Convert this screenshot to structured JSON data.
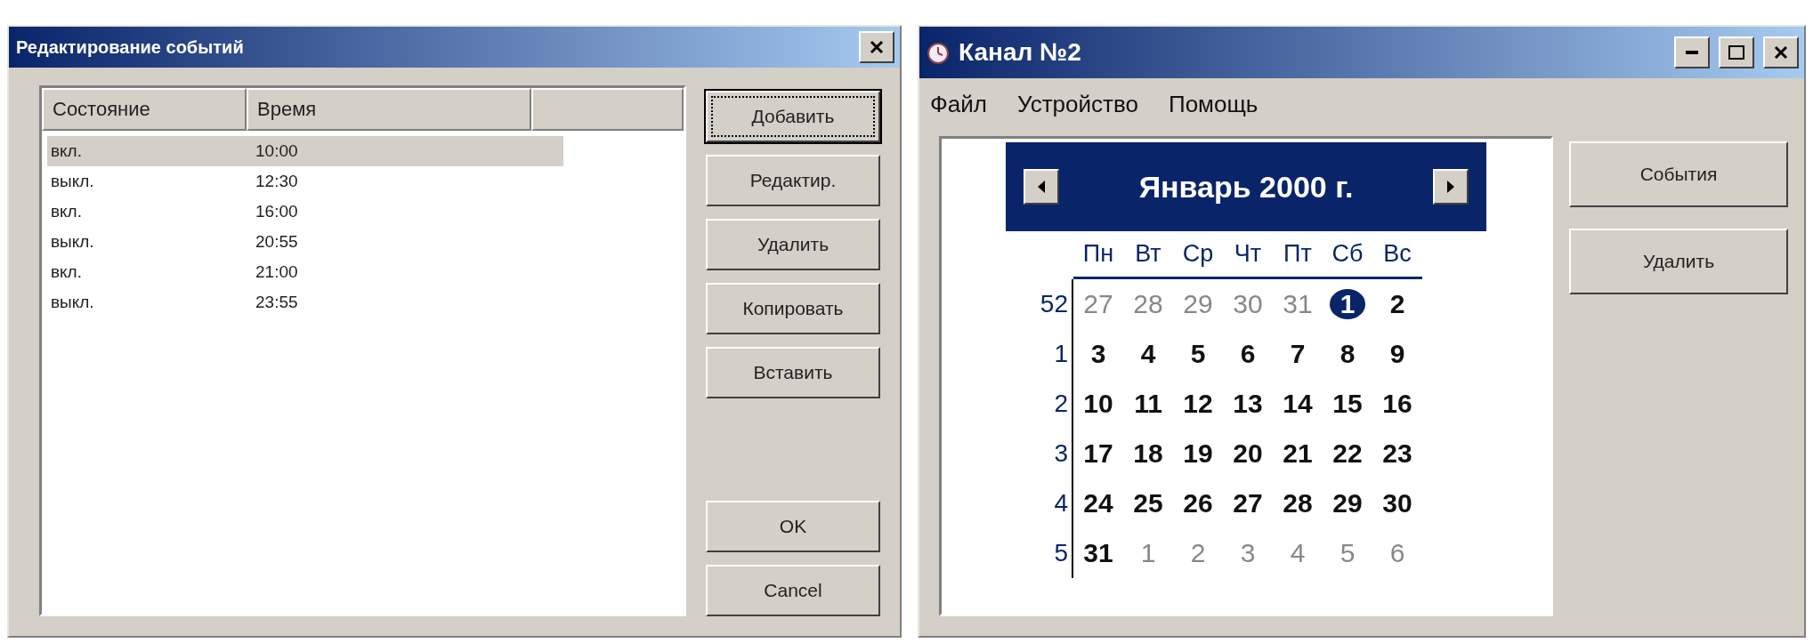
{
  "events_dialog": {
    "title": "Редактирование событий",
    "columns": [
      "Состояние",
      "Время"
    ],
    "rows": [
      {
        "state": "вкл.",
        "time": "10:00",
        "selected": true
      },
      {
        "state": "выкл.",
        "time": "12:30",
        "selected": false
      },
      {
        "state": "вкл.",
        "time": "16:00",
        "selected": false
      },
      {
        "state": "выкл.",
        "time": "20:55",
        "selected": false
      },
      {
        "state": "вкл.",
        "time": "21:00",
        "selected": false
      },
      {
        "state": "выкл.",
        "time": "23:55",
        "selected": false
      }
    ],
    "buttons": [
      {
        "label": "Добавить",
        "focused": true
      },
      {
        "label": "Редактир.",
        "focused": false
      },
      {
        "label": "Удалить",
        "focused": false
      },
      {
        "label": "Копировать",
        "focused": false
      },
      {
        "label": "Вставить",
        "focused": false
      }
    ],
    "footer_buttons": [
      "OK",
      "Cancel"
    ]
  },
  "channel_window": {
    "title": "Канал №2",
    "menu": [
      "Файл",
      "Устройство",
      "Помощь"
    ],
    "calendar": {
      "month": "Январь 2000 г.",
      "weekdays": [
        "Пн",
        "Вт",
        "Ср",
        "Чт",
        "Пт",
        "Сб",
        "Вс"
      ],
      "weeks": [
        {
          "number": "52",
          "days": [
            {
              "day": "27",
              "muted": true,
              "selected": false
            },
            {
              "day": "28",
              "muted": true,
              "selected": false
            },
            {
              "day": "29",
              "muted": true,
              "selected": false
            },
            {
              "day": "30",
              "muted": true,
              "selected": false
            },
            {
              "day": "31",
              "muted": true,
              "selected": false
            },
            {
              "day": "1",
              "muted": false,
              "selected": true
            },
            {
              "day": "2",
              "muted": false,
              "selected": false
            }
          ]
        },
        {
          "number": "1",
          "days": [
            {
              "day": "3",
              "muted": false,
              "selected": false
            },
            {
              "day": "4",
              "muted": false,
              "selected": false
            },
            {
              "day": "5",
              "muted": false,
              "selected": false
            },
            {
              "day": "6",
              "muted": false,
              "selected": false
            },
            {
              "day": "7",
              "muted": false,
              "selected": false
            },
            {
              "day": "8",
              "muted": false,
              "selected": false
            },
            {
              "day": "9",
              "muted": false,
              "selected": false
            }
          ]
        },
        {
          "number": "2",
          "days": [
            {
              "day": "10",
              "muted": false,
              "selected": false
            },
            {
              "day": "11",
              "muted": false,
              "selected": false
            },
            {
              "day": "12",
              "muted": false,
              "selected": false
            },
            {
              "day": "13",
              "muted": false,
              "selected": false
            },
            {
              "day": "14",
              "muted": false,
              "selected": false
            },
            {
              "day": "15",
              "muted": false,
              "selected": false
            },
            {
              "day": "16",
              "muted": false,
              "selected": false
            }
          ]
        },
        {
          "number": "3",
          "days": [
            {
              "day": "17",
              "muted": false,
              "selected": false
            },
            {
              "day": "18",
              "muted": false,
              "selected": false
            },
            {
              "day": "19",
              "muted": false,
              "selected": false
            },
            {
              "day": "20",
              "muted": false,
              "selected": false
            },
            {
              "day": "21",
              "muted": false,
              "selected": false
            },
            {
              "day": "22",
              "muted": false,
              "selected": false
            },
            {
              "day": "23",
              "muted": false,
              "selected": false
            }
          ]
        },
        {
          "number": "4",
          "days": [
            {
              "day": "24",
              "muted": false,
              "selected": false
            },
            {
              "day": "25",
              "muted": false,
              "selected": false
            },
            {
              "day": "26",
              "muted": false,
              "selected": false
            },
            {
              "day": "27",
              "muted": false,
              "selected": false
            },
            {
              "day": "28",
              "muted": false,
              "selected": false
            },
            {
              "day": "29",
              "muted": false,
              "selected": false
            },
            {
              "day": "30",
              "muted": false,
              "selected": false
            }
          ]
        },
        {
          "number": "5",
          "days": [
            {
              "day": "31",
              "muted": false,
              "selected": false
            },
            {
              "day": "1",
              "muted": true,
              "selected": false
            },
            {
              "day": "2",
              "muted": true,
              "selected": false
            },
            {
              "day": "3",
              "muted": true,
              "selected": false
            },
            {
              "day": "4",
              "muted": true,
              "selected": false
            },
            {
              "day": "5",
              "muted": true,
              "selected": false
            },
            {
              "day": "6",
              "muted": true,
              "selected": false
            }
          ]
        }
      ]
    },
    "buttons": [
      "События",
      "Удалить"
    ]
  }
}
